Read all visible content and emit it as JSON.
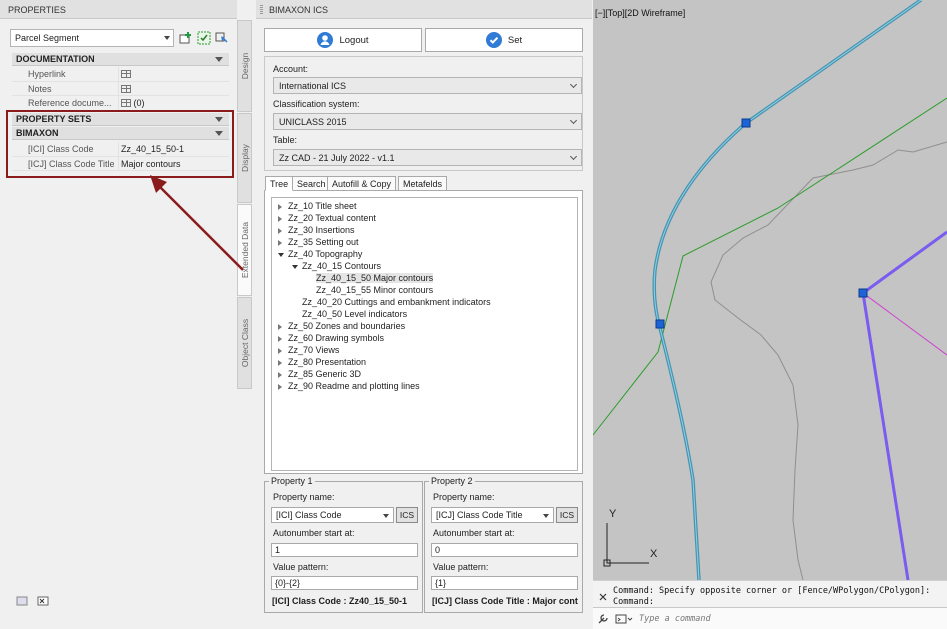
{
  "properties": {
    "title": "PROPERTIES",
    "object_type": "Parcel Segment",
    "sections": {
      "documentation": "DOCUMENTATION",
      "property_sets": "PROPERTY SETS",
      "bimaxon": "BIMAXON"
    },
    "documentation_rows": [
      {
        "key": "Hyperlink",
        "value": ""
      },
      {
        "key": "Notes",
        "value": ""
      },
      {
        "key": "Reference docume...",
        "value": "(0)"
      }
    ],
    "bimaxon_rows": [
      {
        "key": "[ICI] Class Code",
        "value": "Zz_40_15_50-1"
      },
      {
        "key": "[ICJ] Class Code Title",
        "value": "Major contours"
      }
    ],
    "side_tabs": [
      "Design",
      "Display",
      "Extended Data",
      "Object Class"
    ],
    "active_side_tab": "Extended Data",
    "annotation_color": "#8b1c1c"
  },
  "bimaxon": {
    "title": "BIMAXON ICS",
    "logout_label": "Logout",
    "set_label": "Set",
    "account_label": "Account:",
    "account_value": "International ICS",
    "classification_label": "Classification system:",
    "classification_value": "UNICLASS 2015",
    "table_label": "Table:",
    "table_value": "Zz CAD - 21 July 2022 - v1.1",
    "tabs": [
      "Tree",
      "Search",
      "Autofill & Copy",
      "Metafelds"
    ],
    "active_tab": "Tree",
    "tree": [
      {
        "label": "Zz_10 Title sheet"
      },
      {
        "label": "Zz_20 Textual content"
      },
      {
        "label": "Zz_30 Insertions"
      },
      {
        "label": "Zz_35 Setting out"
      },
      {
        "label": "Zz_40 Topography"
      },
      {
        "label": "Zz_40_15 Contours"
      },
      {
        "label": "Zz_40_15_50 Major contours"
      },
      {
        "label": "Zz_40_15_55 Minor contours"
      },
      {
        "label": "Zz_40_20 Cuttings and embankment indicators"
      },
      {
        "label": "Zz_40_50 Level indicators"
      },
      {
        "label": "Zz_50 Zones and boundaries"
      },
      {
        "label": "Zz_60 Drawing symbols"
      },
      {
        "label": "Zz_70 Views"
      },
      {
        "label": "Zz_80 Presentation"
      },
      {
        "label": "Zz_85 Generic 3D"
      },
      {
        "label": "Zz_90 Readme and plotting lines"
      }
    ],
    "property1": {
      "legend": "Property 1",
      "name_label": "Property name:",
      "name_value": "[ICI] Class Code",
      "ics": "ICS",
      "autonumber_label": "Autonumber start at:",
      "autonumber_value": "1",
      "pattern_label": "Value pattern:",
      "pattern_value": "{0}-{2}",
      "result": "[ICI] Class Code : Zz40_15_50-1"
    },
    "property2": {
      "legend": "Property 2",
      "name_label": "Property name:",
      "name_value": "[ICJ] Class Code Title",
      "ics": "ICS",
      "autonumber_label": "Autonumber start at:",
      "autonumber_value": "0",
      "pattern_label": "Value pattern:",
      "pattern_value": "{1}",
      "result": "[ICJ] Class Code Title : Major cont"
    },
    "accent_color": "#2f7bd5"
  },
  "viewport": {
    "label": "[−][Top][2D Wireframe]",
    "ucs_x": "X",
    "ucs_y": "Y",
    "background_color": "#c4c4c4",
    "contour_color": "#3a8fae",
    "line_green": "#2a9d2a",
    "line_purple": "#7a5cf0",
    "line_magenta": "#d03cd0"
  },
  "command": {
    "history": [
      "Command: Specify opposite corner or [Fence/WPolygon/CPolygon]:",
      "Command:"
    ],
    "placeholder": "Type a command"
  }
}
